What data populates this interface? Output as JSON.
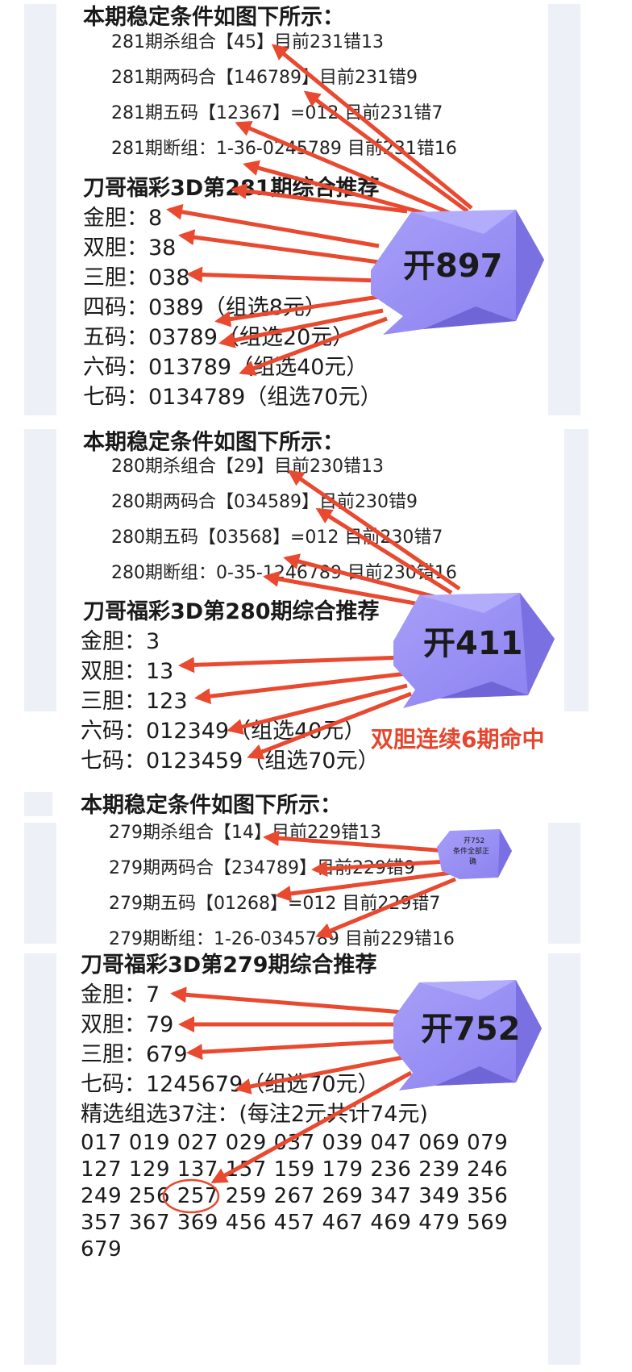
{
  "accent": "#e8492f",
  "gem_color": "#8f85f2",
  "sections": [
    {
      "header": "本期稳定条件如图下所示：",
      "conditions": [
        "281期杀组合【45】目前231错13",
        "281期两码合【146789】目前231错9",
        "281期五码【12367】=012 目前231错7",
        "281期断组：1-36-0245789 目前231错16"
      ],
      "title": "刀哥福彩3D第281期综合推荐",
      "rows": [
        "金胆：8",
        "双胆：38",
        "三胆：038",
        "四码：0389（组选8元）",
        "五码：03789（组选20元）",
        "六码：013789（组选40元）",
        "七码：0134789（组选70元）"
      ],
      "result": "开897"
    },
    {
      "header": "本期稳定条件如图下所示：",
      "conditions": [
        "280期杀组合【29】目前230错13",
        "280期两码合【034589】目前230错9",
        "280期五码【03568】=012 目前230错7",
        "280期断组：0-35-1246789 目前230错16"
      ],
      "title": "刀哥福彩3D第280期综合推荐",
      "rows": [
        "金胆：3",
        "双胆：13",
        "三胆：123",
        "六码：012349（组选40元）",
        "七码：0123459（组选70元）"
      ],
      "result": "开411",
      "note": "双胆连续6期命中"
    },
    {
      "header": "本期稳定条件如图下所示：",
      "conditions": [
        "279期杀组合【14】目前229错13",
        "279期两码合【234789】目前229错9",
        "279期五码【01268】=012 目前229错7",
        "279期断组：1-26-0345789 目前229错16"
      ],
      "small_gem": [
        "开752",
        "条件全部正",
        "确"
      ],
      "title": "刀哥福彩3D第279期综合推荐",
      "rows": [
        "金胆：7",
        "双胆：79",
        "三胆：679",
        "七码：1245679（组选70元）",
        "精选组选37注：(每注2元共计74元)"
      ],
      "numbers": [
        "017 019 027 029 037 039 047 069 079",
        "127 129 137 157 159 179 236 239 246",
        "249 256 257 259 267 269 347 349 356",
        "357 367 369 456 457 467 469 479 569",
        "679"
      ],
      "result": "开752"
    }
  ]
}
